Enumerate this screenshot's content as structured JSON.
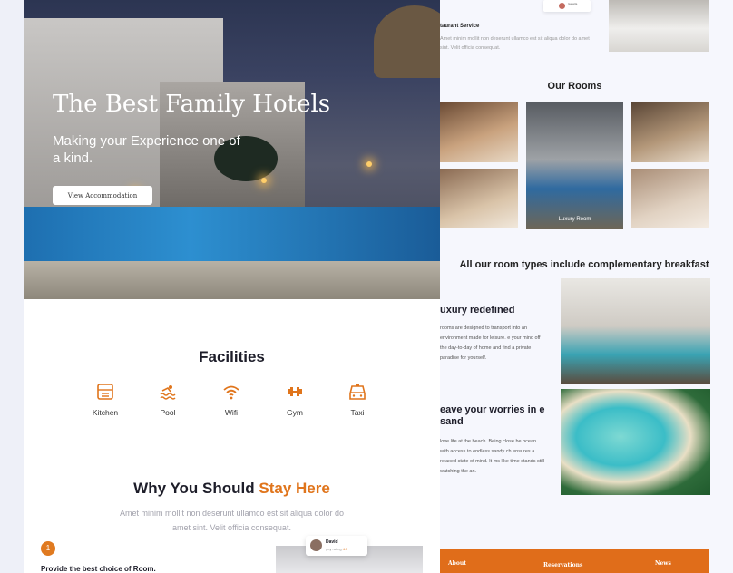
{
  "hero": {
    "title": "The Best Family Hotels",
    "subtitle": "Making your Experience one of a kind.",
    "cta_label": "View Accommodation"
  },
  "facilities": {
    "title": "Facilities",
    "items": [
      {
        "label": "Kitchen",
        "icon": "kitchen-icon"
      },
      {
        "label": "Pool",
        "icon": "pool-icon"
      },
      {
        "label": "Wifi",
        "icon": "wifi-icon"
      },
      {
        "label": "Gym",
        "icon": "gym-icon"
      },
      {
        "label": "Taxi",
        "icon": "taxi-icon"
      }
    ]
  },
  "why": {
    "title_prefix": "Why You Should ",
    "title_highlight": "Stay Here",
    "text": "Amet minim mollit non deserunt ullamco est sit aliqua dolor do amet sint. Velit officia consequat.",
    "step_number": "1",
    "step_title": "Provide the best choice of Room.",
    "review": {
      "name": "David",
      "rating_label": "guy rating",
      "rating_value": "4.5"
    }
  },
  "right_top": {
    "service_title": "taurant Service",
    "service_text": "Amet minim mollit non deserunt ullamco est sit aliqua dolor do amet sint. Velit officia consequat.",
    "mini_card_name": "Isabella"
  },
  "rooms": {
    "title": "Our Rooms",
    "featured_caption": "Luxury Room"
  },
  "breakfast_banner": "All our room types include complementary breakfast",
  "sections": [
    {
      "heading": "uxury redefined",
      "text": "rooms are designed to transport into an environment made for leisure. e your mind off the day-to-day of home and find a private paradise for yourself."
    },
    {
      "heading": "eave your worries in e sand",
      "text": "love life at the beach. Being close he ocean with access to endless sandy ch ensures a relaxed state of mind. It ms like time stands still watching the an."
    }
  ],
  "footer": {
    "about": "About",
    "reservations": "Reservations",
    "news": "News"
  },
  "colors": {
    "accent": "#e0751c",
    "footer": "#e06d1a"
  }
}
